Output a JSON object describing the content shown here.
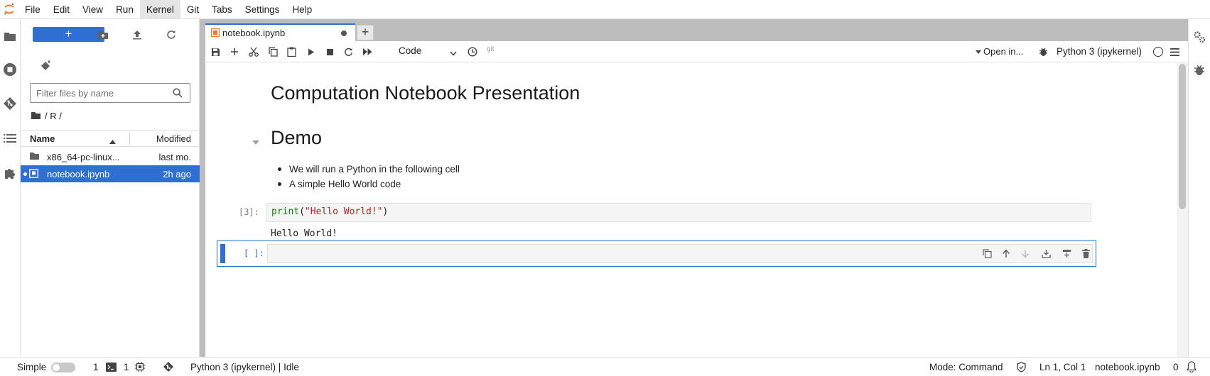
{
  "menubar": {
    "items": [
      "File",
      "Edit",
      "View",
      "Run",
      "Kernel",
      "Git",
      "Tabs",
      "Settings",
      "Help"
    ],
    "active_item": "Kernel"
  },
  "filebrowser": {
    "new_label": "+",
    "search_placeholder": "Filter files by name",
    "breadcrumb": "/ R /",
    "columns": {
      "name": "Name",
      "modified": "Modified"
    },
    "files": [
      {
        "name": "x86_64-pc-linux...",
        "modified": "last mo.",
        "type": "folder"
      },
      {
        "name": "notebook.ipynb",
        "modified": "2h ago",
        "type": "notebook",
        "selected": true
      }
    ]
  },
  "tabs": [
    {
      "label": "notebook.ipynb",
      "dirty": true
    }
  ],
  "add_tab_label": "+",
  "toolbar": {
    "cell_type": "Code",
    "git_label": "git",
    "open_in": "Open in...",
    "kernel": "Python 3 (ipykernel)"
  },
  "notebook": {
    "title": "Computation Notebook Presentation",
    "section": "Demo",
    "bullets": [
      "We will run a Python in the following cell",
      "A simple Hello World code"
    ],
    "code_prompt": "[3]:",
    "code_fn": "print",
    "code_open": "(",
    "code_string": "\"Hello World!\"",
    "code_close": ")",
    "output": "Hello World!",
    "empty_prompt": "[ ]:"
  },
  "statusbar": {
    "mode_simple": "Simple",
    "terminals_count": "1",
    "kernels_count": "1",
    "kernel_status": "Python 3 (ipykernel) | Idle",
    "mode": "Mode: Command",
    "cursor": "Ln 1, Col 1",
    "filename": "notebook.ipynb",
    "notifications": "0"
  },
  "colors": {
    "accent": "#2f6fd4",
    "dock_bg": "#bdbdbd",
    "code_keyword": "#0b7d0b",
    "code_string": "#ba2121"
  }
}
